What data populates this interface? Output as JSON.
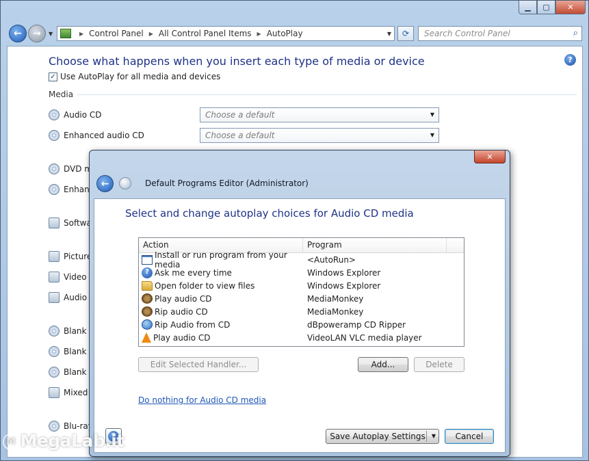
{
  "addressbar": {
    "crumbs": [
      "Control Panel",
      "All Control Panel Items",
      "AutoPlay"
    ],
    "search_placeholder": "Search Control Panel"
  },
  "autoplay": {
    "title": "Choose what happens when you insert each type of media or device",
    "use_autoplay_label": "Use AutoPlay for all media and devices",
    "use_autoplay_checked": true,
    "section_media": "Media",
    "items": [
      {
        "label": "Audio CD",
        "value": "Choose a default"
      },
      {
        "label": "Enhanced audio CD",
        "value": "Choose a default"
      },
      {
        "label": "DVD mo"
      },
      {
        "label": "Enhanc"
      },
      {
        "label": "Softwa"
      },
      {
        "label": "Pictures"
      },
      {
        "label": "Video fi"
      },
      {
        "label": "Audio fi"
      },
      {
        "label": "Blank C"
      },
      {
        "label": "Blank D"
      },
      {
        "label": "Blank Bl"
      },
      {
        "label": "Mixed c"
      },
      {
        "label": "Blu-ray"
      }
    ]
  },
  "dialog": {
    "window_title": "Default Programs Editor (Administrator)",
    "heading": "Select and change autoplay choices for Audio CD media",
    "columns": [
      "Action",
      "Program"
    ],
    "handlers": [
      {
        "action": "Install or run program from your media",
        "program": "<AutoRun>",
        "icon": "install-icon"
      },
      {
        "action": "Ask me every time",
        "program": "Windows Explorer",
        "icon": "question-icon"
      },
      {
        "action": "Open folder to view files",
        "program": "Windows Explorer",
        "icon": "folder-icon"
      },
      {
        "action": "Play audio CD",
        "program": "MediaMonkey",
        "icon": "mediamonkey-icon"
      },
      {
        "action": "Rip audio CD",
        "program": "MediaMonkey",
        "icon": "mediamonkey-icon"
      },
      {
        "action": "Rip Audio from CD",
        "program": "dBpoweramp CD Ripper",
        "icon": "dbpoweramp-icon"
      },
      {
        "action": "Play audio CD",
        "program": "VideoLAN VLC media player",
        "icon": "vlc-icon"
      }
    ],
    "edit_button": "Edit Selected Handler...",
    "add_button": "Add...",
    "delete_button": "Delete",
    "do_nothing_link": "Do nothing for Audio CD media",
    "save_button": "Save Autoplay Settings",
    "cancel_button": "Cancel"
  },
  "watermark": "MegaLab.it"
}
